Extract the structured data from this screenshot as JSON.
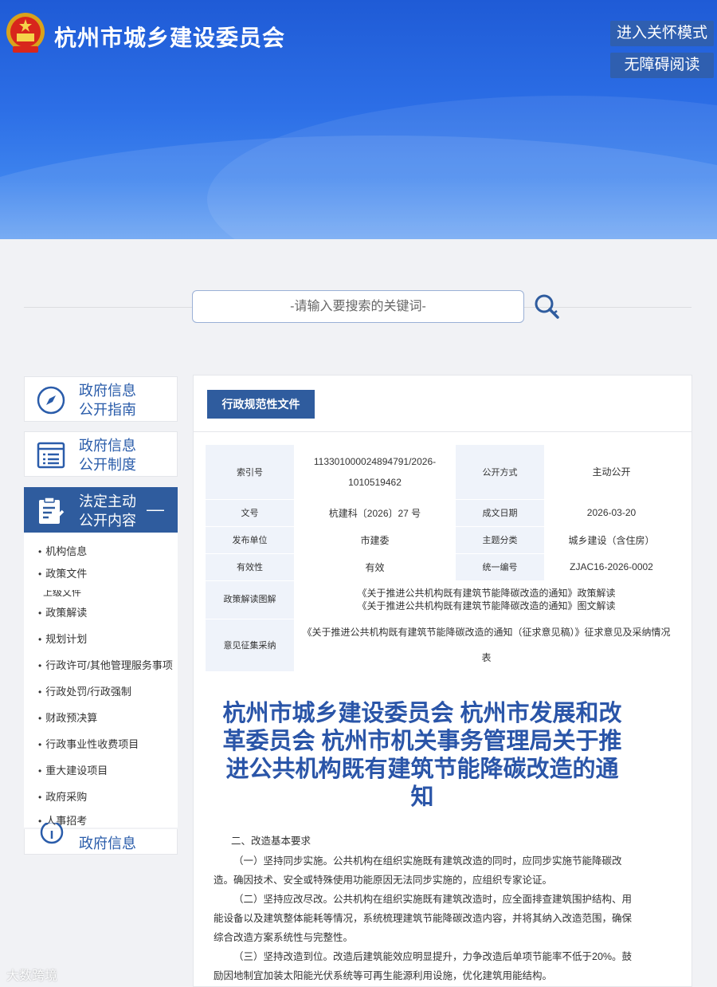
{
  "header": {
    "site_title": "杭州市城乡建设委员会",
    "care_mode": "进入关怀模式",
    "accessible": "无障碍阅读"
  },
  "search": {
    "placeholder": "-请输入要搜索的关键词-"
  },
  "sidebar": {
    "card1": {
      "line1": "政府信息",
      "line2": "公开指南"
    },
    "card2": {
      "line1": "政府信息",
      "line2": "公开制度"
    },
    "card3": {
      "line1": "法定主动",
      "line2": "公开内容",
      "toggle": "—"
    },
    "items": [
      "机构信息",
      "政策文件",
      "政策解读",
      "规划计划",
      "行政许可/其他管理服务事项",
      "行政处罚/行政强制",
      "财政预决算",
      "行政事业性收费项目",
      "重大建设项目",
      "政府采购",
      "人事招考"
    ],
    "cut_item": "上级文件",
    "bottom": "政府信息"
  },
  "main": {
    "tab": "行政规范性文件",
    "meta": {
      "index_label": "索引号",
      "index_value": "113301000024894791/2026-1010519462",
      "method_label": "公开方式",
      "method_value": "主动公开",
      "docno_label": "文号",
      "docno_value": "杭建科〔2026〕27 号",
      "date_label": "成文日期",
      "date_value": "2026-03-20",
      "issuer_label": "发布单位",
      "issuer_value": "市建委",
      "topic_label": "主题分类",
      "topic_value": "城乡建设（含住房）",
      "validity_label": "有效性",
      "validity_value": "有效",
      "code_label": "统一编号",
      "code_value": "ZJAC16-2026-0002",
      "interp_label": "政策解读图解",
      "interp_line1": "《关于推进公共机构既有建筑节能降碳改造的通知》政策解读",
      "interp_line2": "《关于推进公共机构既有建筑节能降碳改造的通知》图文解读",
      "opinion_label": "意见征集采纳",
      "opinion_value": "《关于推进公共机构既有建筑节能降碳改造的通知（征求意见稿）》征求意见及采纳情况表"
    },
    "title": "杭州市城乡建设委员会 杭州市发展和改革委员会 杭州市机关事务管理局关于推进公共机构既有建筑节能降碳改造的通知",
    "section": "二、改造基本要求",
    "para1": "（一）坚持同步实施。公共机构在组织实施既有建筑改造的同时，应同步实施节能降碳改造。确因技术、安全或特殊使用功能原因无法同步实施的，应组织专家论证。",
    "para2": "（二）坚持应改尽改。公共机构在组织实施既有建筑改造时，应全面排查建筑围护结构、用能设备以及建筑整体能耗等情况，系统梳理建筑节能降碳改造内容，并将其纳入改造范围，确保综合改造方案系统性与完整性。",
    "para3": "（三）坚持改造到位。改造后建筑能效应明显提升，力争改造后单项节能率不低于20%。鼓励因地制宜加装太阳能光伏系统等可再生能源利用设施，优化建筑用能结构。"
  },
  "watermark": "大数跨境"
}
